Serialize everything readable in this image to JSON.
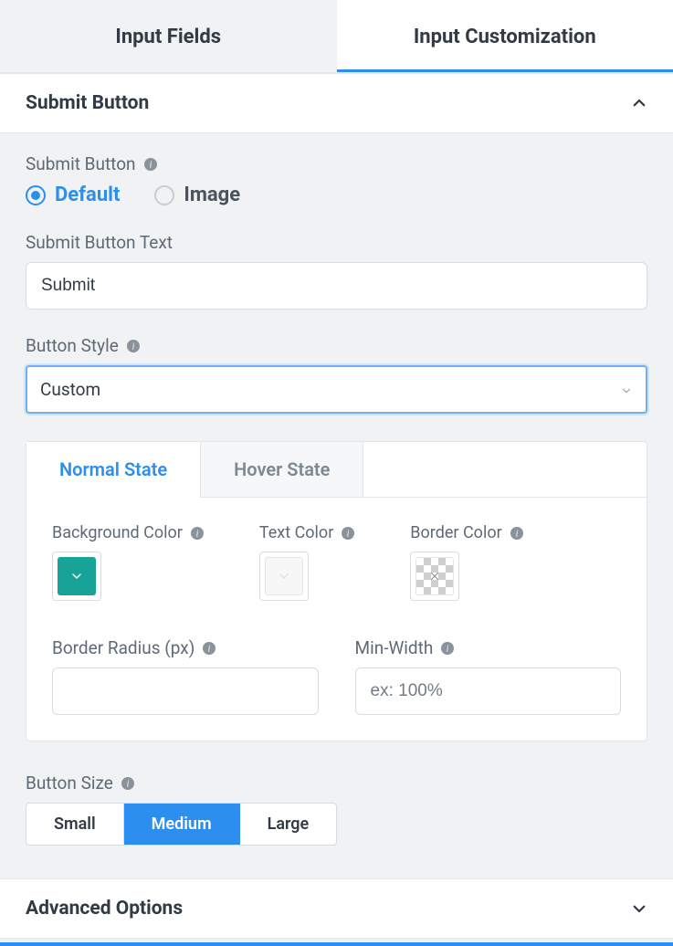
{
  "top_tabs": {
    "inactive": "Input Fields",
    "active": "Input Customization"
  },
  "accordion": {
    "submit_button_title": "Submit Button",
    "advanced_options_title": "Advanced Options"
  },
  "submit_button_section": {
    "type_label": "Submit Button",
    "options": {
      "default": "Default",
      "image": "Image"
    },
    "text_label": "Submit Button Text",
    "text_value": "Submit",
    "style_label": "Button Style",
    "style_value": "Custom"
  },
  "state_tabs": {
    "normal": "Normal State",
    "hover": "Hover State"
  },
  "colors": {
    "bg_label": "Background Color",
    "text_label": "Text Color",
    "border_label": "Border Color",
    "bg_value": "#17a398",
    "text_value": "#f7f7f7",
    "border_value": "transparent"
  },
  "dims": {
    "radius_label": "Border Radius (px)",
    "radius_value": "",
    "width_label": "Min-Width",
    "width_placeholder": "ex: 100%"
  },
  "size": {
    "label": "Button Size",
    "options": {
      "small": "Small",
      "medium": "Medium",
      "large": "Large"
    },
    "selected": "medium"
  }
}
